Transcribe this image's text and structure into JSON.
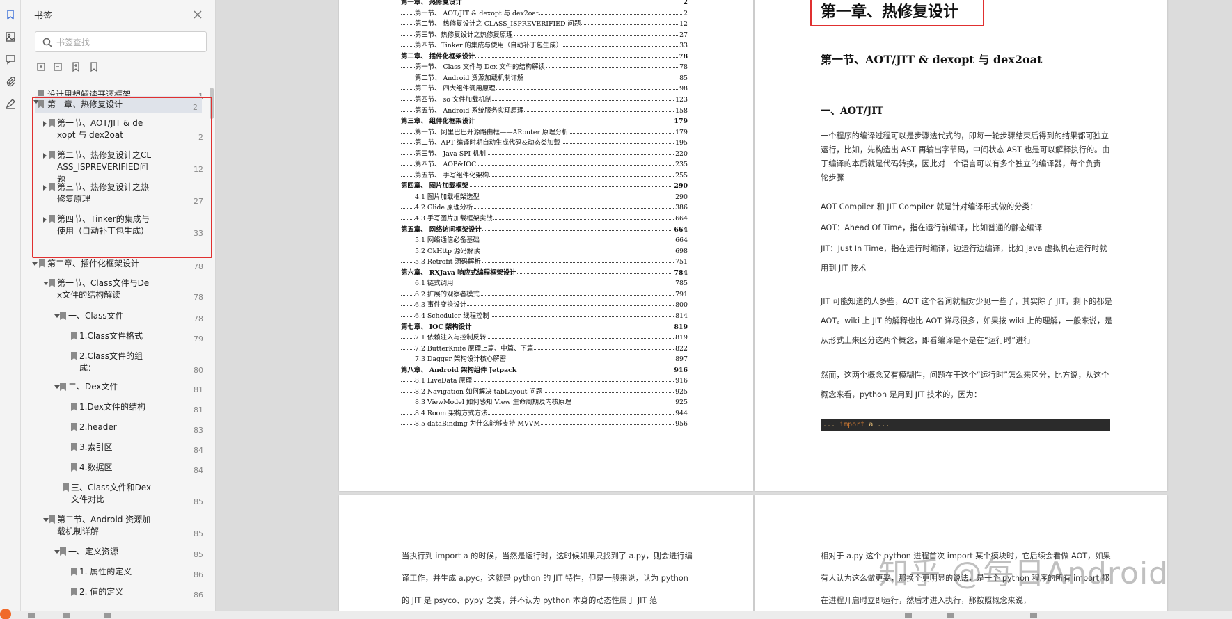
{
  "rail": {
    "icons": [
      "bookmark-icon",
      "image-thumbnail-icon",
      "comment-icon",
      "attachment-icon",
      "signature-icon"
    ]
  },
  "panel": {
    "title": "书签",
    "search_placeholder": "书签查找",
    "tools": [
      "expand-all-icon",
      "collapse-all-icon",
      "add-bookmark-icon",
      "bookmark-outline-icon"
    ],
    "items": [
      {
        "label": "设计思想解读开源框架",
        "page": "1"
      },
      {
        "label": "第一章、热修复设计",
        "page": "2"
      },
      {
        "label": "第一节、AOT/JIT & dexopt 与 dex2oat",
        "page": "2"
      },
      {
        "label": "第二节、热修复设计之CLASS_ISPREVERIFIED问题",
        "page": "12"
      },
      {
        "label": "第三节、热修复设计之热修复原理",
        "page": "27"
      },
      {
        "label": "第四节、Tinker的集成与使用（自动补丁包生成）",
        "page": "33"
      },
      {
        "label": "第二章、插件化框架设计",
        "page": "78"
      },
      {
        "label": "第一节、Class文件与Dex文件的结构解读",
        "page": "78"
      },
      {
        "label": "一、Class文件",
        "page": "78"
      },
      {
        "label": "1.Class文件格式",
        "page": "79"
      },
      {
        "label": "2.Class文件的组成：",
        "page": "80"
      },
      {
        "label": "二、Dex文件",
        "page": "81"
      },
      {
        "label": "1.Dex文件的结构",
        "page": "81"
      },
      {
        "label": "2.header",
        "page": "83"
      },
      {
        "label": "3.索引区",
        "page": "84"
      },
      {
        "label": "4.数据区",
        "page": "84"
      },
      {
        "label": "三、Class文件和Dex文件对比",
        "page": "85"
      },
      {
        "label": "第二节、Android 资源加载机制详解",
        "page": "85"
      },
      {
        "label": "一、定义资源",
        "page": "85"
      },
      {
        "label": "1. 属性的定义",
        "page": "86"
      },
      {
        "label": "2. 值的定义",
        "page": "86"
      }
    ]
  },
  "toc": [
    {
      "text": "第一章、 热修复设计",
      "page": "2",
      "bold": true,
      "indent": 0
    },
    {
      "text": "第一节、 AOT/JIT & dexopt 与 dex2oat",
      "page": "2",
      "bold": false,
      "indent": 1
    },
    {
      "text": "第二节、 热修复设计之 CLASS_ISPREVERIFIED 问题",
      "page": "12",
      "bold": false,
      "indent": 1
    },
    {
      "text": "第三节、热修复设计之热修复原理",
      "page": "27",
      "bold": false,
      "indent": 1
    },
    {
      "text": "第四节、Tinker 的集成与使用（自动补丁包生成）",
      "page": "33",
      "bold": false,
      "indent": 1
    },
    {
      "text": "第二章、 插件化框架设计",
      "page": "78",
      "bold": true,
      "indent": 0
    },
    {
      "text": "第一节、 Class 文件与 Dex 文件的结构解读",
      "page": "78",
      "bold": false,
      "indent": 1
    },
    {
      "text": "第二节、 Android 资源加载机制详解",
      "page": "85",
      "bold": false,
      "indent": 1
    },
    {
      "text": "第三节、 四大组件调用原理",
      "page": "98",
      "bold": false,
      "indent": 1
    },
    {
      "text": "第四节、 so 文件加载机制",
      "page": "123",
      "bold": false,
      "indent": 1
    },
    {
      "text": "第五节、 Android 系统服务实现原理",
      "page": "158",
      "bold": false,
      "indent": 1
    },
    {
      "text": "第三章、 组件化框架设计",
      "page": "179",
      "bold": true,
      "indent": 0
    },
    {
      "text": "第一节、阿里巴巴开源路由框——ARouter 原理分析",
      "page": "179",
      "bold": false,
      "indent": 1
    },
    {
      "text": "第二节、APT 编译时期自动生成代码&动态类加载",
      "page": "195",
      "bold": false,
      "indent": 1
    },
    {
      "text": "第三节、 Java SPI 机制",
      "page": "220",
      "bold": false,
      "indent": 1
    },
    {
      "text": "第四节、 AOP&IOC",
      "page": "235",
      "bold": false,
      "indent": 1
    },
    {
      "text": "第五节、 手写组件化架构",
      "page": "255",
      "bold": false,
      "indent": 1
    },
    {
      "text": "第四章、 图片加载框架",
      "page": "290",
      "bold": true,
      "indent": 0
    },
    {
      "text": "4.1 图片加载框架选型",
      "page": "290",
      "bold": false,
      "indent": 1
    },
    {
      "text": "4.2 Glide 原理分析",
      "page": "386",
      "bold": false,
      "indent": 1
    },
    {
      "text": "4.3 手写图片加载框架实战",
      "page": "664",
      "bold": false,
      "indent": 1
    },
    {
      "text": "第五章、 网络访问框架设计",
      "page": "664",
      "bold": true,
      "indent": 0
    },
    {
      "text": "5.1 网络通信必备基础",
      "page": "664",
      "bold": false,
      "indent": 1
    },
    {
      "text": "5.2 OkHttp 源码解读",
      "page": "698",
      "bold": false,
      "indent": 1
    },
    {
      "text": "5.3 Retrofit 源码解析",
      "page": "751",
      "bold": false,
      "indent": 1
    },
    {
      "text": "第六章、 RXJava 响应式编程框架设计",
      "page": "784",
      "bold": true,
      "indent": 0
    },
    {
      "text": "6.1 链式调用",
      "page": "785",
      "bold": false,
      "indent": 1
    },
    {
      "text": "6.2 扩展的观察者模式",
      "page": "791",
      "bold": false,
      "indent": 1
    },
    {
      "text": "6.3 事件变换设计",
      "page": "800",
      "bold": false,
      "indent": 1
    },
    {
      "text": "6.4 Scheduler 线程控制",
      "page": "814",
      "bold": false,
      "indent": 1
    },
    {
      "text": "第七章、 IOC 架构设计",
      "page": "819",
      "bold": true,
      "indent": 0
    },
    {
      "text": "7.1 依赖注入与控制反转",
      "page": "819",
      "bold": false,
      "indent": 1
    },
    {
      "text": "7.2 ButterKnife 原理上篇、中篇、下篇",
      "page": "822",
      "bold": false,
      "indent": 1
    },
    {
      "text": "7.3 Dagger 架构设计核心解密",
      "page": "897",
      "bold": false,
      "indent": 1
    },
    {
      "text": "第八章、 Android 架构组件 Jetpack",
      "page": "916",
      "bold": true,
      "indent": 0
    },
    {
      "text": "8.1 LiveData 原理",
      "page": "916",
      "bold": false,
      "indent": 1
    },
    {
      "text": "8.2 Navigation 如何解决 tabLayout 问题",
      "page": "925",
      "bold": false,
      "indent": 1
    },
    {
      "text": "8.3 ViewModel 如何感知 View 生命周期及内核原理",
      "page": "925",
      "bold": false,
      "indent": 1
    },
    {
      "text": "8.4 Room 架构方式方法",
      "page": "944",
      "bold": false,
      "indent": 1
    },
    {
      "text": "8.5 dataBinding 为什么能够支持 MVVM",
      "page": "956",
      "bold": false,
      "indent": 1
    }
  ],
  "page2": {
    "chapter": "第一章、热修复设计",
    "section": "第一节、AOT/JIT & dexopt 与 dex2oat",
    "sub": "一、AOT/JIT",
    "para1": "一个程序的编译过程可以是步骤迭代式的，即每一轮步骤结束后得到的结果都可独立运行，比如，先构造出 AST 再输出字节码，中间状态 AST 也是可以解释执行的。由于编译的本质就是代码转换，因此对一个语言可以有多个独立的编译器，每个负责一轮步骤",
    "para2": "AOT Compiler 和 JIT Compiler 就是针对编译形式做的分类：",
    "para3": "AOT：Ahead Of Time，指在运行前编译，比如普通的静态编译",
    "para4": "JIT：Just In Time，指在运行时编译，边运行边编译，比如 java 虚拟机在运行时就用到 JIT 技术",
    "para5": "JIT 可能知道的人多些，AOT 这个名词就相对少见一些了，其实除了 JIT，剩下的都是 AOT。wiki 上 JIT 的解释也比 AOT 详尽很多，如果按 wiki 上的理解，一般来说，是从形式上来区分这两个概念，即看编译是不是在“运行时”进行",
    "para6": "然而，这两个概念又有模糊性，问题在于这个“运行时”怎么来区分，比方说，从这个概念来看，python 是用到 JIT 技术的，因为：",
    "code_prefix": "... ",
    "code_keyword": "import",
    "code_rest": " a ..."
  },
  "page3": {
    "text": "当执行到 import a 的时候，当然是运行时，这时候如果只找到了 a.py，则会进行编译工作，并生成 a.pyc，这就是 python 的 JIT 特性，但是一般来说，认为 python 的 JIT 是 psyco、pypy 之类，并不认为 python 本身的动态性属于 JIT 范"
  },
  "page4": {
    "text": "相对于 a.py 这个 python 进程首次 import 某个模块时，它后续会看做 AOT，如果有人认为这么做更妥，那换个更明显的说法，是一个 python 程序的所有 import 都在进程开启时立即运行，然后才进入执行，那按照概念来说，"
  },
  "watermark": "知乎 @每日Android"
}
